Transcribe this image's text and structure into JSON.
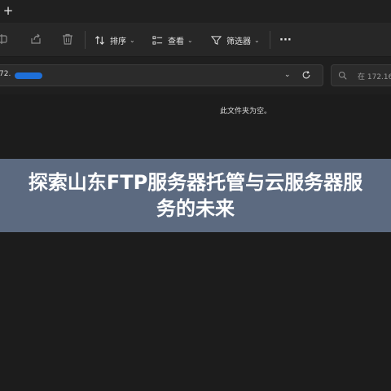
{
  "titlebar": {
    "new_tab_symbol": "+"
  },
  "toolbar": {
    "icons": [
      "rename-icon",
      "share-icon",
      "delete-icon"
    ],
    "sort_label": "排序",
    "view_label": "查看",
    "filter_label": "筛选器",
    "more_label": "···"
  },
  "address": {
    "path_visible": "72.",
    "dropdown_symbol": "⌄",
    "search_placeholder": "在 172.16"
  },
  "content": {
    "empty_message": "此文件夹为空。"
  },
  "banner": {
    "title": "探索山东FTP服务器托管与云服务器服务的未来",
    "background_color": "#5c6a80"
  }
}
